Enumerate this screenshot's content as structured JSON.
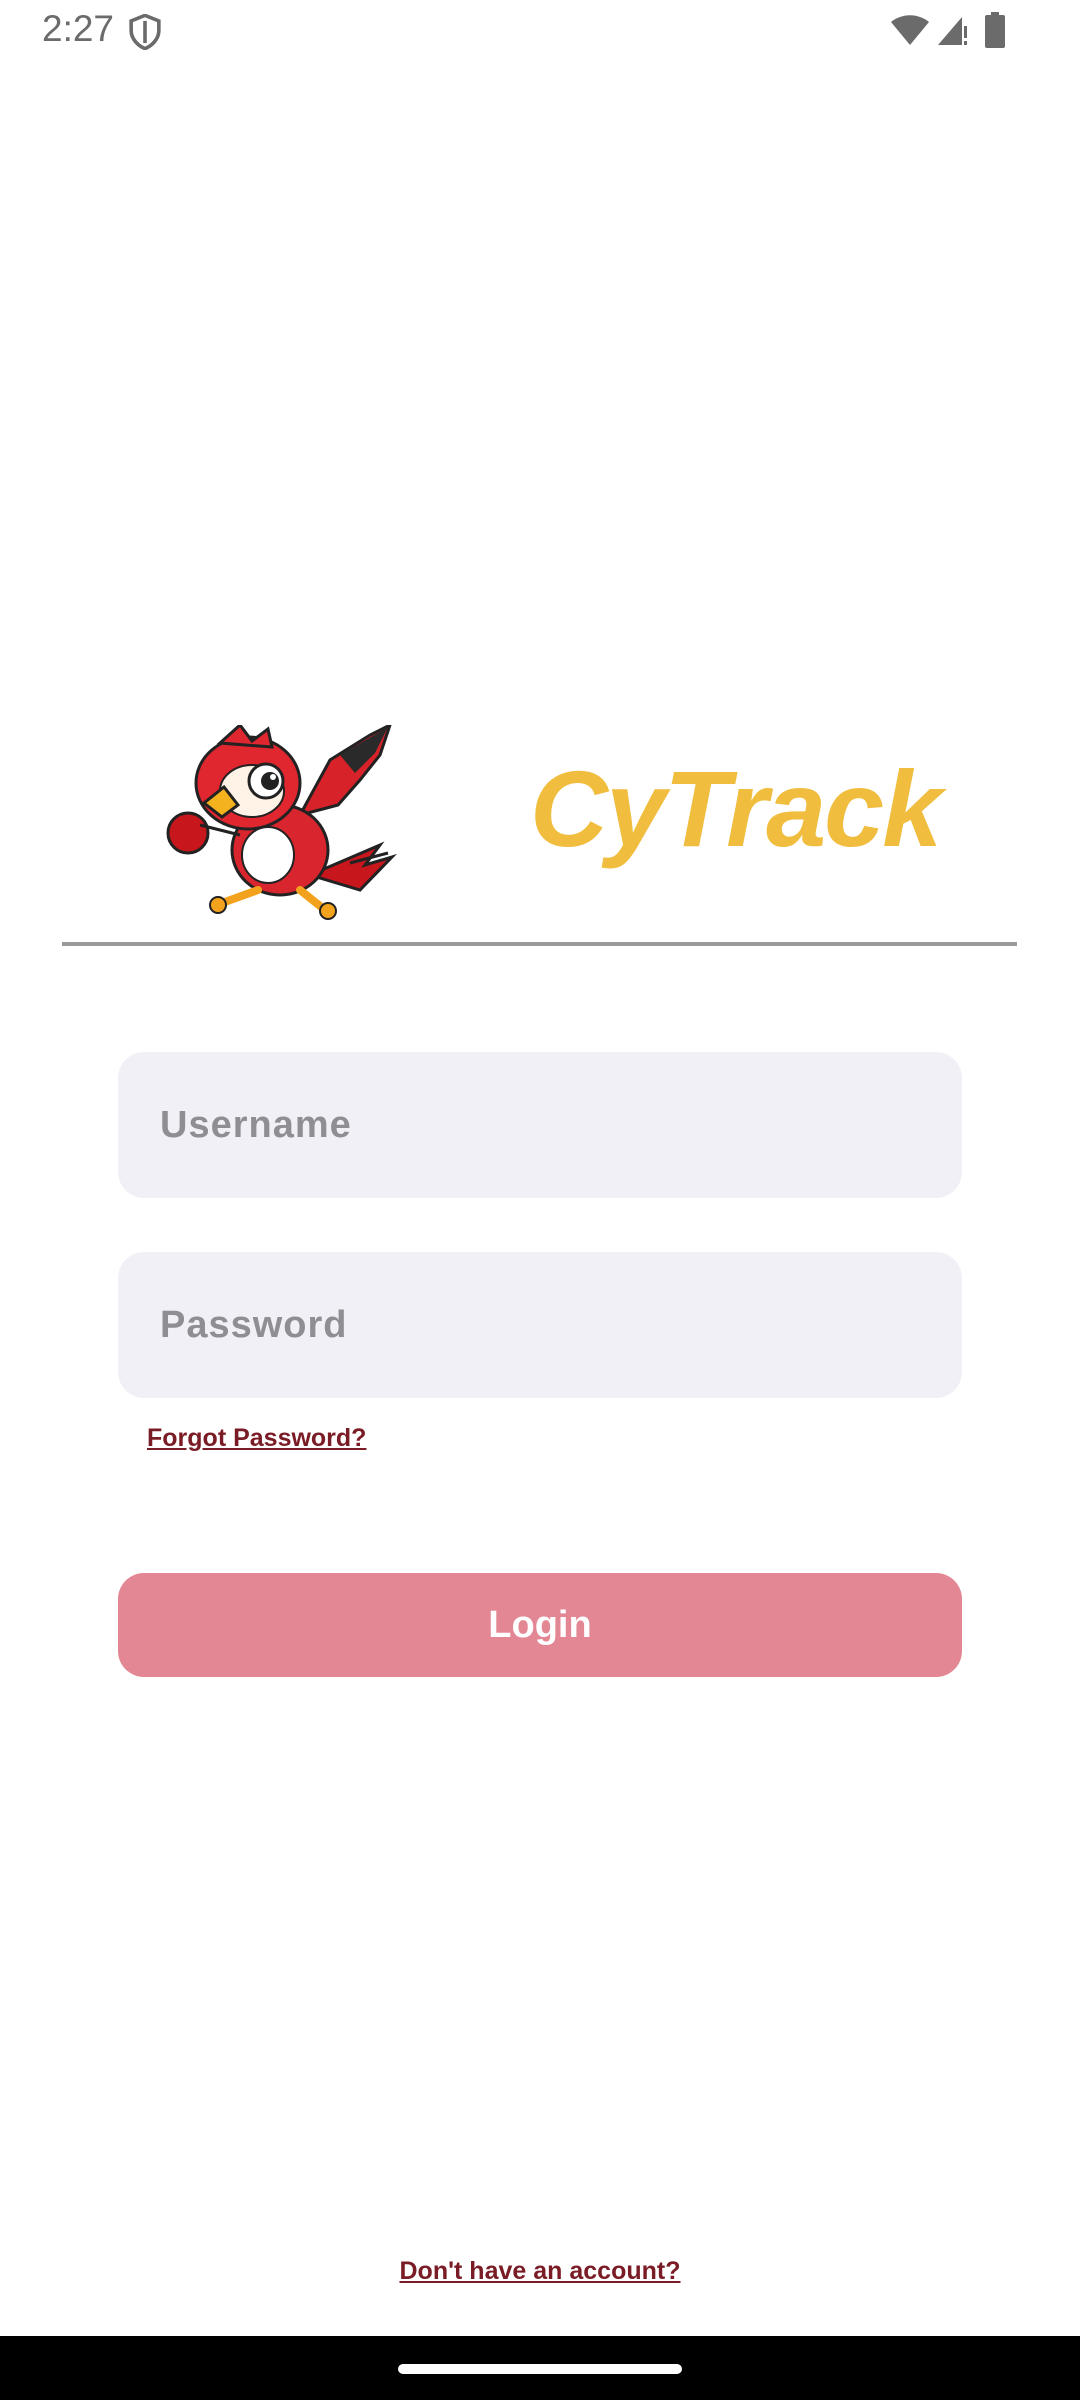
{
  "status_bar": {
    "time": "2:27",
    "icons": [
      "shield-icon",
      "wifi-icon",
      "cell-signal-icon",
      "battery-icon"
    ]
  },
  "header": {
    "app_title": "CyTrack",
    "mascot": "cardinal-mascot"
  },
  "form": {
    "username": {
      "placeholder": "Username",
      "value": ""
    },
    "password": {
      "placeholder": "Password",
      "value": ""
    },
    "forgot_password_label": "Forgot Password?",
    "login_label": "Login"
  },
  "footer": {
    "signup_label": "Don't have an account?"
  },
  "colors": {
    "title": "#f0bd3e",
    "login_button": "#e38794",
    "link": "#7a1c25",
    "field_bg": "#f1f0f6"
  }
}
